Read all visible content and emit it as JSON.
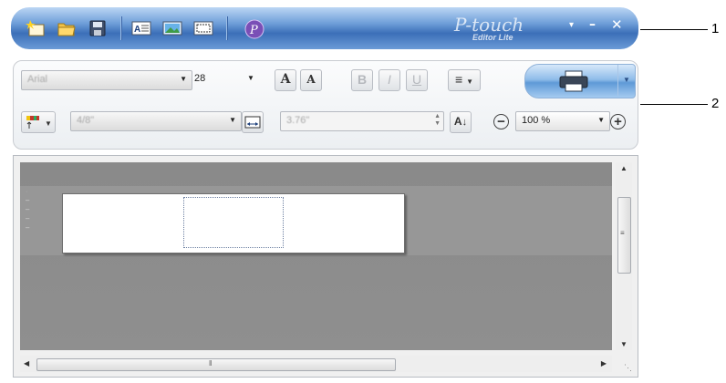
{
  "titlebar": {
    "brand_name": "P-touch",
    "brand_sub": "Editor Lite",
    "minimize_label": "–",
    "close_label": "✕",
    "menu_label": "▾"
  },
  "palette": {
    "font_name": "Arial",
    "font_size": "28",
    "format_value": "4/8\"",
    "length_value": "3.76\"",
    "zoom_value": "100 %",
    "increase_font_label": "A",
    "decrease_font_label": "A",
    "bold_label": "B",
    "italic_label": "I",
    "underline_label": "U",
    "align_label": "≡",
    "vertical_label": "A",
    "zoom_out_label": "−",
    "zoom_in_label": "+"
  },
  "callouts": {
    "one": "1",
    "two": "2"
  },
  "colors": {
    "titlebar_accent": "#3c6fb8",
    "print_button": "#5f9ad7",
    "canvas_background": "#8f8f8f"
  }
}
